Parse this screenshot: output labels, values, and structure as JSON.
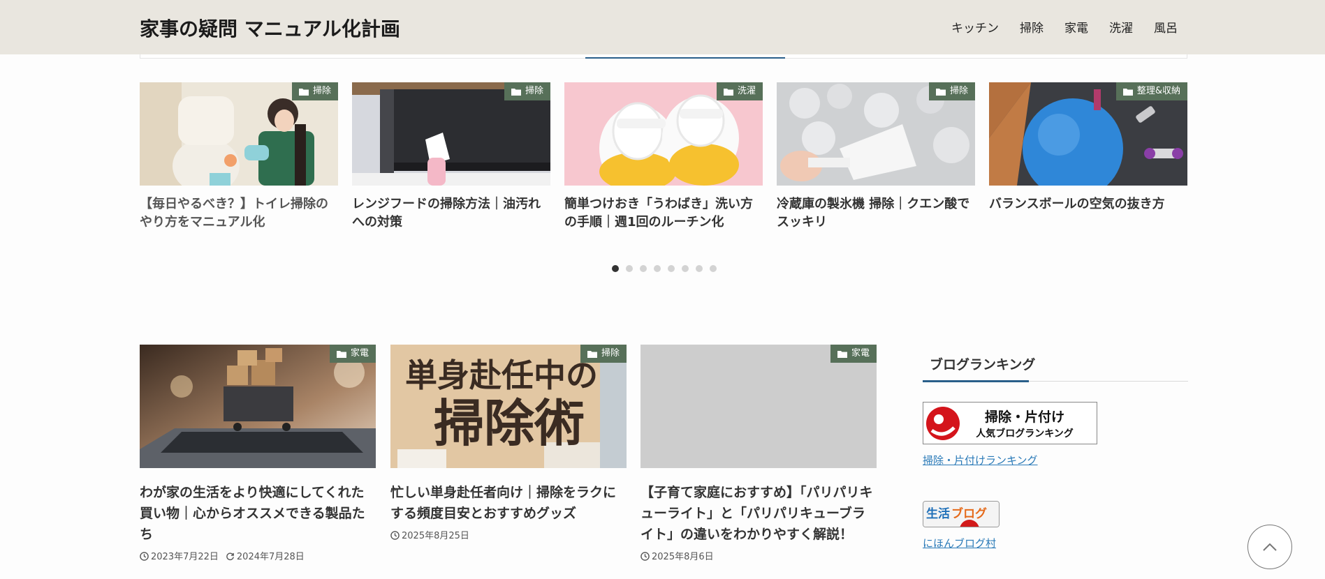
{
  "site": {
    "title": "家事の疑問 マニュアル化計画"
  },
  "nav": [
    "キッチン",
    "掃除",
    "家電",
    "洗濯",
    "風呂"
  ],
  "carousel": [
    {
      "category": "掃除",
      "title": "【毎日やるべき？】トイレ掃除のやり方をマニュアル化",
      "image": "toilet-cleaning-photo"
    },
    {
      "category": "掃除",
      "title": "レンジフードの掃除方法｜油汚れへの対策",
      "image": "range-hood-photo"
    },
    {
      "category": "洗濯",
      "title": "簡単つけおき「うわばき」洗い方の手順｜週1回のルーチン化",
      "image": "school-shoes-photo"
    },
    {
      "category": "掃除",
      "title": "冷蔵庫の製氷機 掃除｜クエン酸でスッキリ",
      "image": "ice-maker-photo"
    },
    {
      "category": "整理&収納",
      "title": "バランスボールの空気の抜き方",
      "image": "balance-ball-photo"
    }
  ],
  "carousel_dots": {
    "count": 8,
    "active_index": 0
  },
  "entries": [
    {
      "category": "家電",
      "title": "わが家の生活をより快適にしてくれた買い物｜心からオススメできる製品たち",
      "date": "2023年7月22日",
      "updated": "2024年7月28日",
      "image": "shopping-cart-laptop-photo"
    },
    {
      "category": "掃除",
      "title": "忙しい単身赴任者向け｜掃除をラクにする頻度目安とおすすめグッズ",
      "date": "2025年8月25日",
      "image_text_top": "単身赴任中の",
      "image_text_bottom": "掃除術"
    },
    {
      "category": "家電",
      "title": "【子育て家庭におすすめ】「パリパリキューライト」と「パリパリキューブライト」の違いをわかりやすく解説！",
      "date": "2025年8月6日",
      "image": "placeholder-gray"
    }
  ],
  "sidebar": {
    "heading": "ブログランキング",
    "banner1": {
      "line1": "掃除・片付け",
      "line2": "人気ブログランキング"
    },
    "link1": "掃除・片付けランキング",
    "banner2": {
      "text_a": "生活",
      "text_b": "ブログ"
    },
    "link2": "にほんブログ村"
  },
  "icons": {
    "category": "folder-icon",
    "date": "clock-icon",
    "updated": "refresh-icon",
    "to_top": "chevron-up-icon"
  },
  "colors": {
    "header_bg": "#e9e6df",
    "category_badge": "#577059",
    "link": "#2a7ab8",
    "accent_line": "#2a5f8a"
  }
}
